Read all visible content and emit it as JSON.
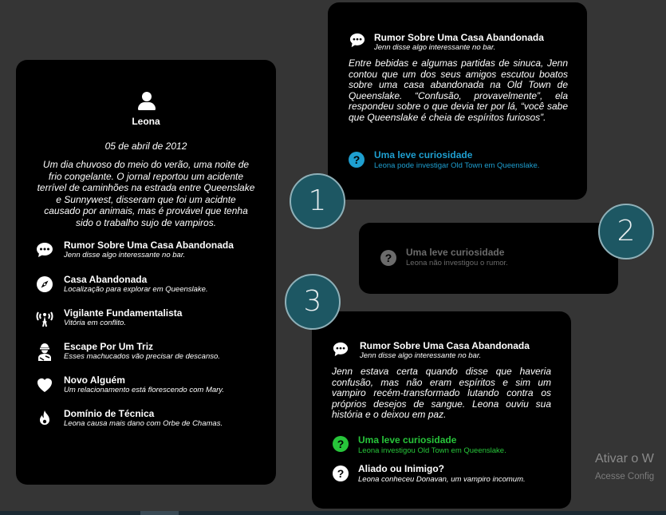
{
  "character": {
    "name": "Leona",
    "date": "05 de abril de 2012",
    "story": "Um dia chuvoso do meio do verão, uma noite de frio congelante. O jornal reportou um acidente terrível de caminhões na estrada entre Queenslake e Sunnywest, disseram que foi um acidnte causado por animais, mas é provável que tenha sido o trabalho sujo de vampiros.",
    "events": [
      {
        "title": "Rumor Sobre Uma Casa Abandonada",
        "subtitle": "Jenn disse algo interessante no bar.",
        "icon": "chat-bubble-icon"
      },
      {
        "title": "Casa Abandonada",
        "subtitle": "Localização para explorar em Queenslake.",
        "icon": "compass-icon"
      },
      {
        "title": "Vigilante Fundamentalista",
        "subtitle": "Vitória em conflito.",
        "icon": "broadcast-person-icon"
      },
      {
        "title": "Escape Por Um Triz",
        "subtitle": "Esses machucados vão precisar de descanso.",
        "icon": "injured-person-icon"
      },
      {
        "title": "Novo Alguém",
        "subtitle": "Um relacionamento está florescendo com Mary.",
        "icon": "heart-icon"
      },
      {
        "title": "Domínio de Técnica",
        "subtitle": "Leona causa mais dano com Orbe de Chamas.",
        "icon": "flame-icon"
      }
    ]
  },
  "card1": {
    "title": "Rumor Sobre Uma Casa Abandonada",
    "subtitle": "Jenn disse algo interessante no bar.",
    "body": "Entre bebidas e algumas partidas de sinuca, Jenn contou que um dos seus amigos escutou boatos sobre uma casa abandonada na Old Town de Queenslake. “Confusão, provavelmente”, ela respondeu sobre o que devia ter por lá, “você sabe que Queenslake é cheia de espíritos furiosos”.",
    "option": {
      "title": "Uma leve curiosidade",
      "subtitle": "Leona pode investigar Old Town em Queenslake."
    }
  },
  "card2": {
    "option": {
      "title": "Uma leve curiosidade",
      "subtitle": "Leona não investigou o rumor."
    }
  },
  "card3": {
    "title": "Rumor Sobre Uma Casa Abandonada",
    "subtitle": "Jenn disse algo interessante no bar.",
    "body": "Jenn estava certa quando disse que haveria confusão, mas não eram espíritos e sim um vampiro recém-transformado lutando contra os próprios desejos de sangue. Leona ouviu sua história e o deixou em paz.",
    "options": [
      {
        "title": "Uma leve curiosidade",
        "subtitle": "Leona investigou Old Town em Queenslake."
      },
      {
        "title": "Aliado ou Inimigo?",
        "subtitle": "Leona conheceu Donavan, um vampiro incomum."
      }
    ]
  },
  "badges": [
    "1",
    "2",
    "3"
  ],
  "watermark": {
    "line1": "Ativar o W",
    "line2": "Acesse Config"
  },
  "colors": {
    "background": "#353535",
    "card": "#000000",
    "blue_option": "#1e9fd0",
    "green_option": "#27c53a",
    "muted_option": "#6b6b6b",
    "badge_fill": "#1d5763"
  }
}
